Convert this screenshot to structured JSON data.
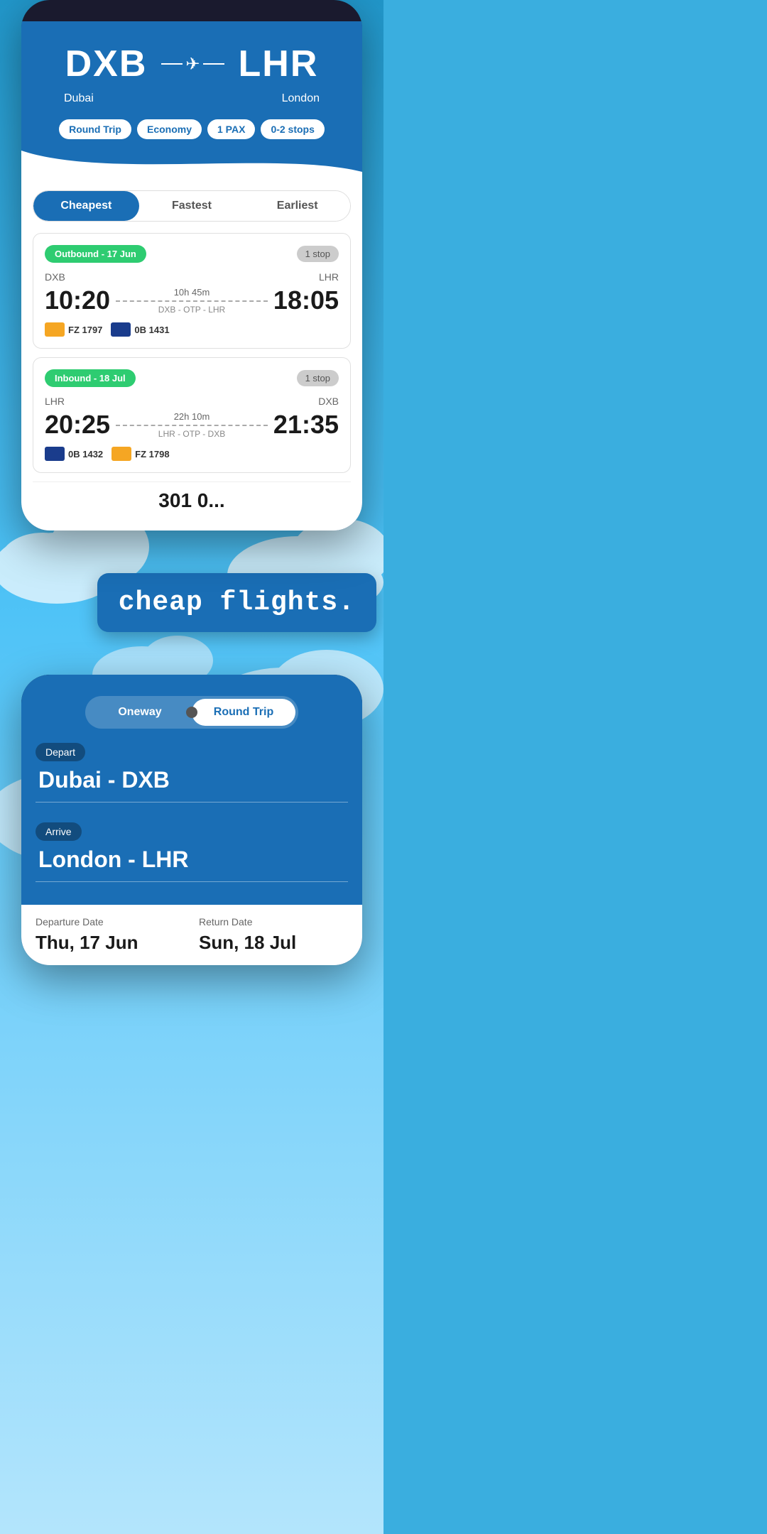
{
  "topPhone": {
    "from_code": "DXB",
    "from_name": "Dubai",
    "to_code": "LHR",
    "to_name": "London",
    "filters": {
      "trip_type": "Round Trip",
      "cabin": "Economy",
      "pax": "1 PAX",
      "stops": "0-2 stops"
    },
    "tabs": {
      "cheapest": "Cheapest",
      "fastest": "Fastest",
      "earliest": "Earliest"
    },
    "outbound": {
      "label": "Outbound - 17 Jun",
      "stops": "1 stop",
      "from": "DXB",
      "to": "LHR",
      "depart": "10:20",
      "arrive": "18:05",
      "duration": "10h 45m",
      "route": "DXB - OTP - LHR",
      "airlines": [
        {
          "code": "FZ 1797",
          "color": "dubai"
        },
        {
          "code": "0B 1431",
          "color": "blue"
        }
      ]
    },
    "inbound": {
      "label": "Inbound - 18 Jul",
      "stops": "1 stop",
      "from": "LHR",
      "to": "DXB",
      "depart": "20:25",
      "arrive": "21:35",
      "duration": "22h 10m",
      "route": "LHR - OTP - DXB",
      "airlines": [
        {
          "code": "0B 1432",
          "color": "blue"
        },
        {
          "code": "FZ 1798",
          "color": "dubai"
        }
      ]
    },
    "price_preview": "301 0..."
  },
  "banner": {
    "text": "cheap flights."
  },
  "bottomPhone": {
    "toggle": {
      "oneway": "Oneway",
      "round_trip": "Round Trip"
    },
    "depart_label": "Depart",
    "depart_city": "Dubai - DXB",
    "arrive_label": "Arrive",
    "arrive_city": "London - LHR",
    "departure_date_label": "Departure Date",
    "departure_date": "Thu, 17 Jun",
    "return_date_label": "Return Date",
    "return_date": "Sun, 18 Jul"
  }
}
